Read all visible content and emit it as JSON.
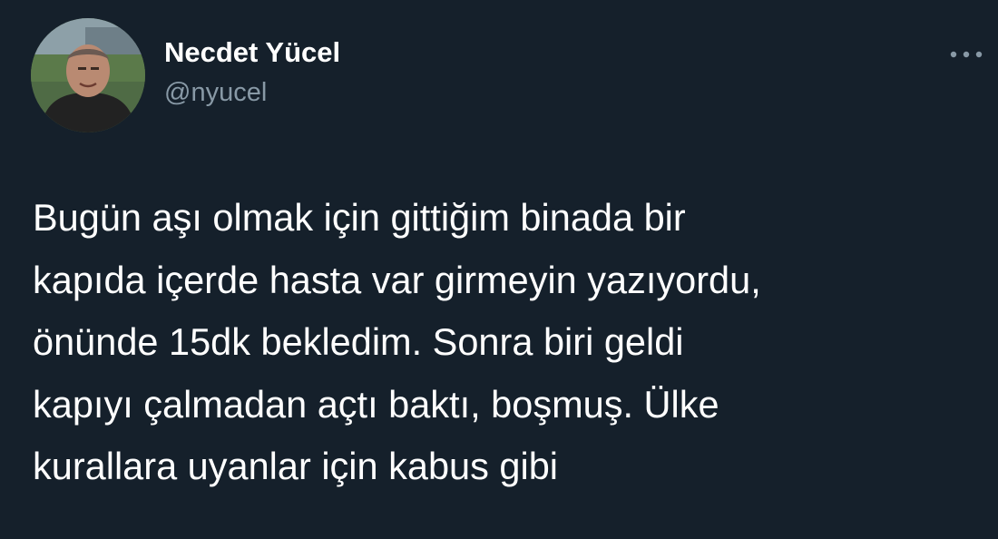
{
  "author": {
    "display_name": "Necdet Yücel",
    "handle": "@nyucel",
    "avatar_icon": "profile-photo"
  },
  "menu": {
    "icon": "more-horizontal-icon"
  },
  "tweet": {
    "lines": [
      "Bugün aşı olmak için gittiğim binada bir",
      "kapıda içerde hasta var girmeyin yazıyordu,",
      "önünde 15dk bekledim. Sonra biri geldi",
      "kapıyı çalmadan açtı baktı, boşmuş. Ülke",
      "kurallara uyanlar için kabus gibi"
    ]
  },
  "colors": {
    "background": "#15202b",
    "text_primary": "#ffffff",
    "text_secondary": "#8899a6"
  }
}
